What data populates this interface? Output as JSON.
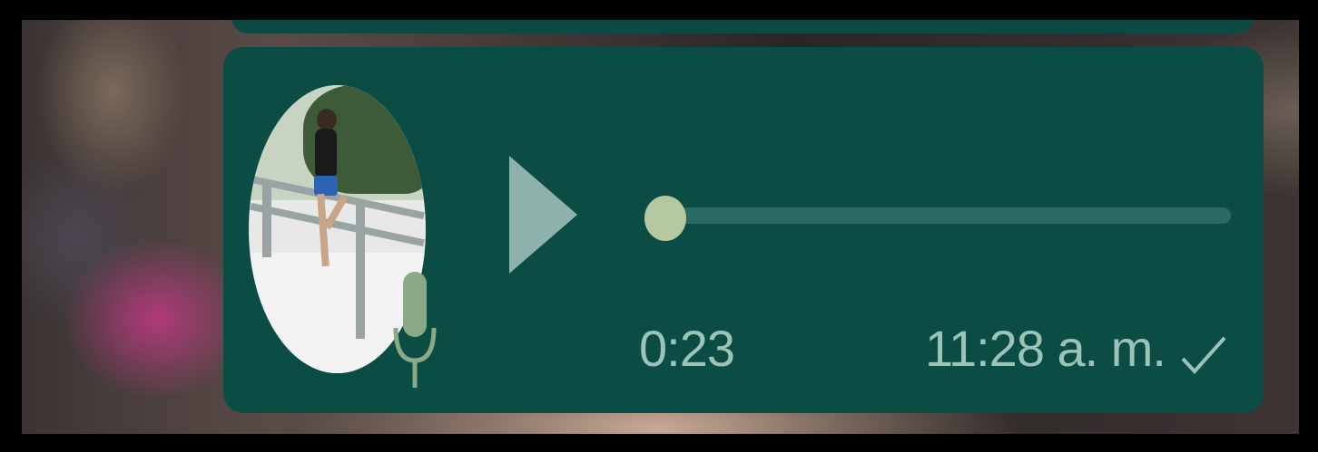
{
  "voice_message": {
    "duration": "0:23",
    "timestamp": "11:28 a. m.",
    "progress": 0.0,
    "play_icon": "play-icon",
    "mic_icon": "microphone-icon",
    "status_icon": "single-check-icon"
  },
  "colors": {
    "bubble": "#0b4d45",
    "accent": "#b5c8a1",
    "text": "#9cc3b8",
    "track": "#2b6a60",
    "play": "#8fb1ab"
  }
}
